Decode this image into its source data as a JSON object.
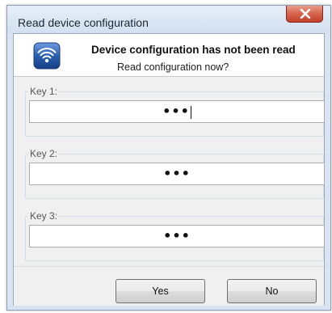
{
  "window": {
    "title": "Read device configuration"
  },
  "header": {
    "icon": "wireless-icon",
    "title": "Device configuration has not been read",
    "subtitle": "Read configuration now?"
  },
  "keys": [
    {
      "label": "Key 1:",
      "value": "•••"
    },
    {
      "label": "Key 2:",
      "value": "•••"
    },
    {
      "label": "Key 3:",
      "value": "•••"
    }
  ],
  "buttons": {
    "yes": "Yes",
    "no": "No"
  },
  "colors": {
    "close_button": "#d45f48",
    "icon_blue": "#2a5fb0"
  }
}
